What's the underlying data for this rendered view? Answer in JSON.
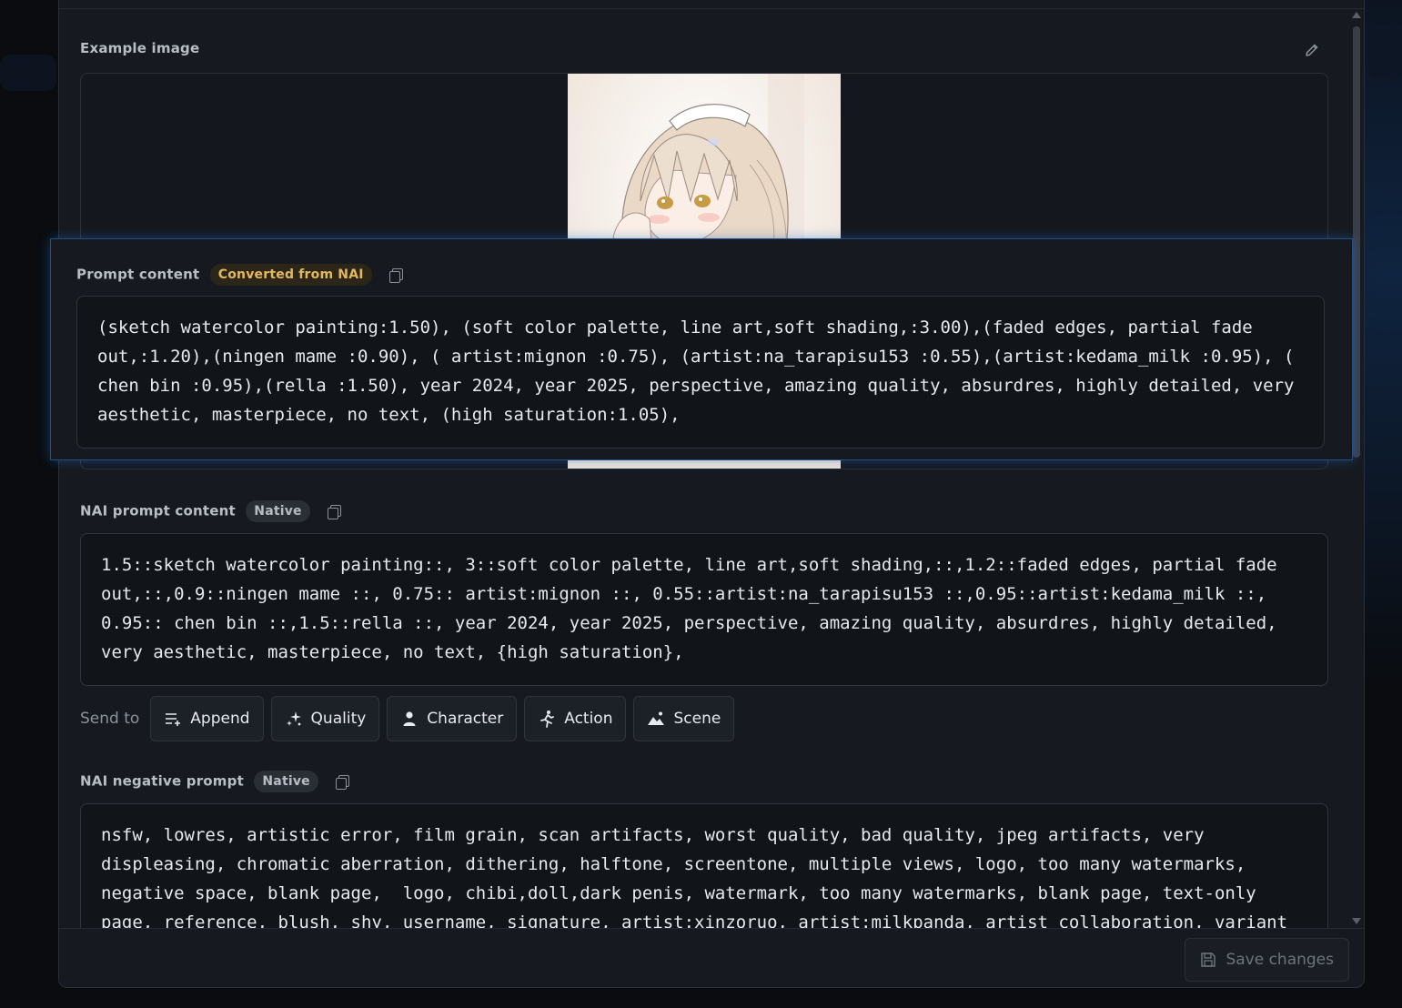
{
  "example_image": {
    "label": "Example image",
    "edit_icon": "pencil-icon"
  },
  "prompt": {
    "label": "Prompt content",
    "badge": "Converted from NAI",
    "text": "(sketch watercolor painting:1.50), (soft color palette, line art,soft shading,:3.00),(faded edges, partial fade out,:1.20),(ningen mame :0.90), ( artist:mignon :0.75), (artist:na_tarapisu153 :0.55),(artist:kedama_milk :0.95), ( chen bin :0.95),(rella :1.50), year 2024, year 2025, perspective, amazing quality, absurdres, highly detailed, very aesthetic, masterpiece, no text, (high saturation:1.05),"
  },
  "nai_prompt": {
    "label": "NAI prompt content",
    "badge": "Native",
    "text": "1.5::sketch watercolor painting::, 3::soft color palette, line art,soft shading,::,1.2::faded edges, partial fade out,::,0.9::ningen mame ::, 0.75:: artist:mignon ::, 0.55::artist:na_tarapisu153 ::,0.95::artist:kedama_milk ::, 0.95:: chen bin ::,1.5::rella ::, year 2024, year 2025, perspective, amazing quality, absurdres, highly detailed, very aesthetic, masterpiece, no text, {high saturation},"
  },
  "send_to": {
    "label": "Send to",
    "buttons": [
      {
        "label": "Append",
        "icon": "append-list-icon"
      },
      {
        "label": "Quality",
        "icon": "sparkles-icon"
      },
      {
        "label": "Character",
        "icon": "person-icon"
      },
      {
        "label": "Action",
        "icon": "running-figure-icon"
      },
      {
        "label": "Scene",
        "icon": "mountain-icon"
      }
    ]
  },
  "nai_negative": {
    "label": "NAI negative prompt",
    "badge": "Native",
    "text": "nsfw, lowres, artistic error, film grain, scan artifacts, worst quality, bad quality, jpeg artifacts, very displeasing, chromatic aberration, dithering, halftone, screentone, multiple views, logo, too many watermarks, negative space, blank page,  logo, chibi,doll,dark penis, watermark, too many watermarks, blank page, text-only page, reference, blush, shy, username, signature, artist:xinzoruo, artist:milkpanda, artist collaboration, variant"
  },
  "footer": {
    "save_label": "Save changes",
    "save_icon": "floppy-disk-icon"
  },
  "colors": {
    "accent_glow": "#1f4f88",
    "badge_nai": "#e3b760"
  }
}
